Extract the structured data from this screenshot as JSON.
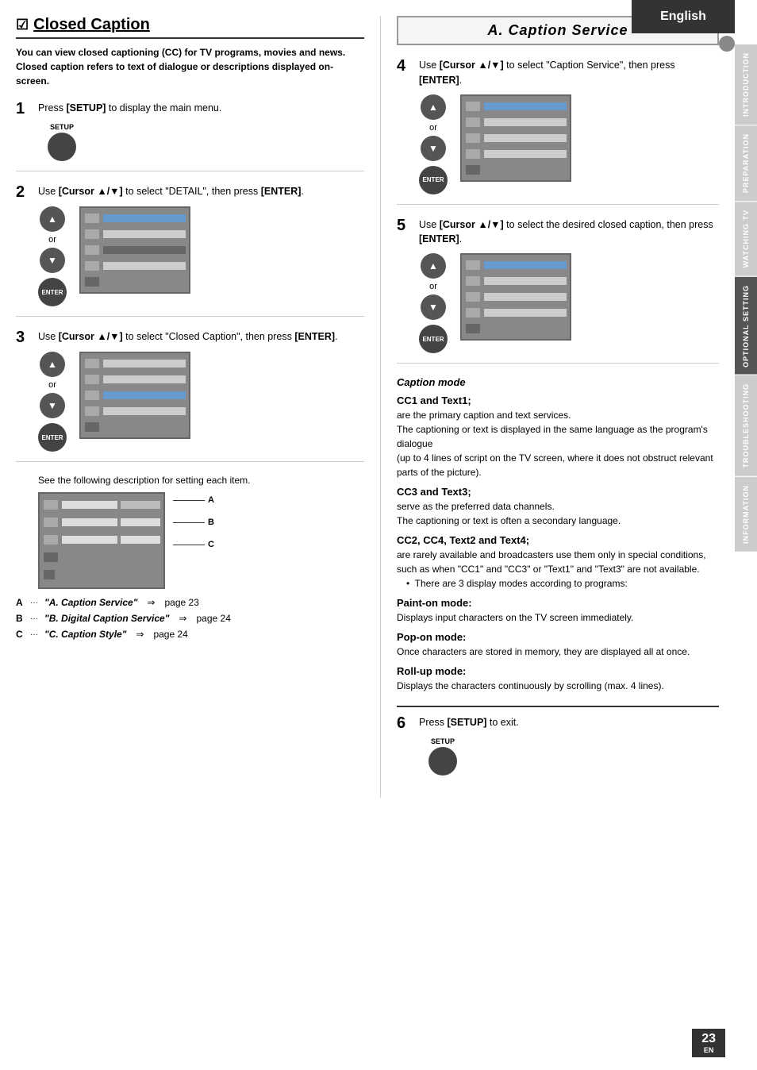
{
  "english_label": "English",
  "sidebar_tabs": [
    {
      "label": "INTRODUCTION",
      "active": false
    },
    {
      "label": "PREPARATION",
      "active": false
    },
    {
      "label": "WATCHING TV",
      "active": false
    },
    {
      "label": "OPTIONAL SETTING",
      "active": true
    },
    {
      "label": "TROUBLESHOOTING",
      "active": false
    },
    {
      "label": "INFORMATION",
      "active": false
    }
  ],
  "left": {
    "title": "Closed Caption",
    "description": "You can view closed captioning (CC) for TV programs, movies and news.\nClosed caption refers to text of dialogue or descriptions displayed on-screen.",
    "steps": [
      {
        "number": "1",
        "text": "Press [SETUP] to display the main menu.",
        "label": "SETUP",
        "has_screen": false,
        "has_enter": false
      },
      {
        "number": "2",
        "text": "Use [Cursor ▲/▼] to select \"DETAIL\", then press [ENTER].",
        "has_screen": true,
        "has_enter": true
      },
      {
        "number": "3",
        "text": "Use [Cursor ▲/▼] to select \"Closed Caption\", then press [ENTER].",
        "has_screen": true,
        "has_enter": true
      }
    ],
    "see_desc": "See the following description for setting each item.",
    "menu_labels": [
      {
        "letter": "A",
        "label": ""
      },
      {
        "letter": "B",
        "label": ""
      },
      {
        "letter": "C",
        "label": ""
      }
    ],
    "ref_items": [
      {
        "letter": "A",
        "name": "\"A. Caption Service\"",
        "page": "page 23"
      },
      {
        "letter": "B",
        "name": "\"B. Digital Caption Service\"",
        "page": "page 24"
      },
      {
        "letter": "C",
        "name": "\"C. Caption Style\"",
        "page": "page 24"
      }
    ]
  },
  "right": {
    "title": "A.  Caption Service",
    "steps": [
      {
        "number": "4",
        "text": "Use [Cursor ▲/▼] to select \"Caption Service\", then press [ENTER].",
        "has_screen": true,
        "has_enter": true
      },
      {
        "number": "5",
        "text": "Use [Cursor ▲/▼] to select the desired closed caption, then press [ENTER].",
        "has_screen": true,
        "has_enter": true
      }
    ],
    "caption_mode_title": "Caption mode",
    "caption_items": [
      {
        "title": "CC1 and Text1;",
        "text": "are the primary caption and text services.\nThe captioning or text is displayed in the same language as the program's dialogue\n(up to 4 lines of script on the TV screen, where it does not obstruct relevant parts of the picture)."
      },
      {
        "title": "CC3 and Text3;",
        "text": "serve as the preferred data channels.\nThe captioning or text is often a secondary language."
      },
      {
        "title": "CC2, CC4, Text2 and Text4;",
        "text": "are rarely available and broadcasters use them only in special conditions, such as when \"CC1\" and \"CC3\" or \"Text1\" and \"Text3\" are not available.",
        "bullet": "There are 3 display modes according to programs:"
      },
      {
        "title": "Paint-on mode:",
        "text": "Displays input characters on the TV screen immediately."
      },
      {
        "title": "Pop-on mode:",
        "text": "Once characters are stored in memory, they are displayed all at once."
      },
      {
        "title": "Roll-up mode:",
        "text": "Displays the characters continuously by scrolling (max. 4 lines)."
      }
    ],
    "step6": {
      "number": "6",
      "text": "Press [SETUP] to exit.",
      "label": "SETUP"
    }
  },
  "page": {
    "number": "23",
    "label": "EN"
  }
}
